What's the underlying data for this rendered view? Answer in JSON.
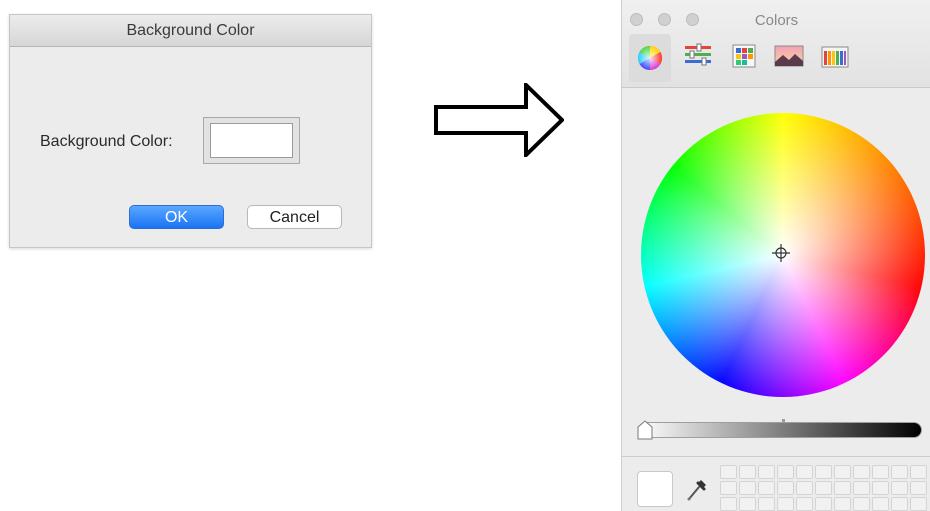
{
  "dialog": {
    "title": "Background Color",
    "field_label": "Background Color:",
    "current_color": "#ffffff",
    "ok_label": "OK",
    "cancel_label": "Cancel",
    "accent_color": "#1a73f4"
  },
  "arrow": {
    "icon": "right-arrow-outline-icon"
  },
  "colors_panel": {
    "title": "Colors",
    "traffic_lights": [
      "close-button",
      "minimize-button",
      "zoom-button"
    ],
    "modes": [
      {
        "name": "color-wheel",
        "icon": "color-wheel-icon",
        "active": true
      },
      {
        "name": "color-sliders",
        "icon": "color-sliders-icon",
        "active": false
      },
      {
        "name": "color-palettes",
        "icon": "color-palettes-icon",
        "active": false
      },
      {
        "name": "image-palettes",
        "icon": "image-palettes-icon",
        "active": false
      },
      {
        "name": "pencils",
        "icon": "pencils-icon",
        "active": false
      }
    ],
    "brightness_level": 0,
    "selected_color": "#ffffff",
    "swatch_rows": 3,
    "swatch_cols": 11
  }
}
